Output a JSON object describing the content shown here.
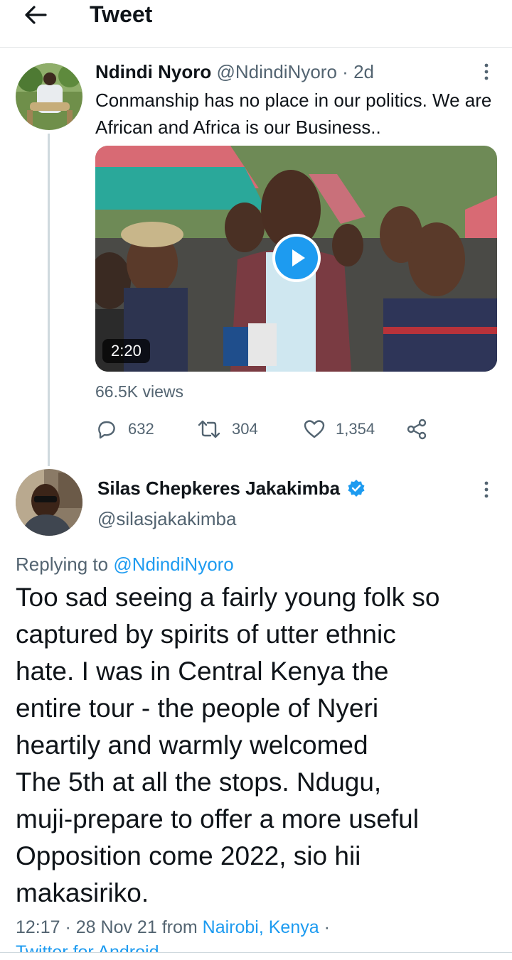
{
  "header": {
    "title": "Tweet",
    "back_icon": "arrow-left-icon"
  },
  "tweet1": {
    "name": "Ndindi Nyoro",
    "handle": "@NdindiNyoro",
    "separator": "·",
    "time": "2d",
    "text": "Conmanship has no place in our politics. We are African and Africa is our Business..",
    "video_duration": "2:20",
    "views": "66.5K views",
    "actions": {
      "replies": "632",
      "retweets": "304",
      "likes": "1,354"
    }
  },
  "tweet2": {
    "name": "Silas Chepkeres Jakakimba",
    "handle": "@silasjakakimba",
    "replying_prefix": "Replying to",
    "replying_to": "@NdindiNyoro",
    "text": "Too sad seeing a fairly young folk so\ncaptured by spirits of utter ethnic\nhate. I was in Central Kenya the\nentire tour - the people of Nyeri\nheartily and warmly welcomed\nThe 5th at all the stops. Ndugu,\nmuji-prepare to offer a more useful\nOpposition come 2022, sio hii\nmakasiriko.",
    "meta_time": "12:17 · 28 Nov 21 from",
    "meta_location": "Nairobi, Kenya",
    "meta_dot": "·",
    "meta_client": "Twitter for Android"
  },
  "colors": {
    "accent": "#1d9bf0",
    "secondary_text": "#536471",
    "border": "#e3e6e8"
  }
}
